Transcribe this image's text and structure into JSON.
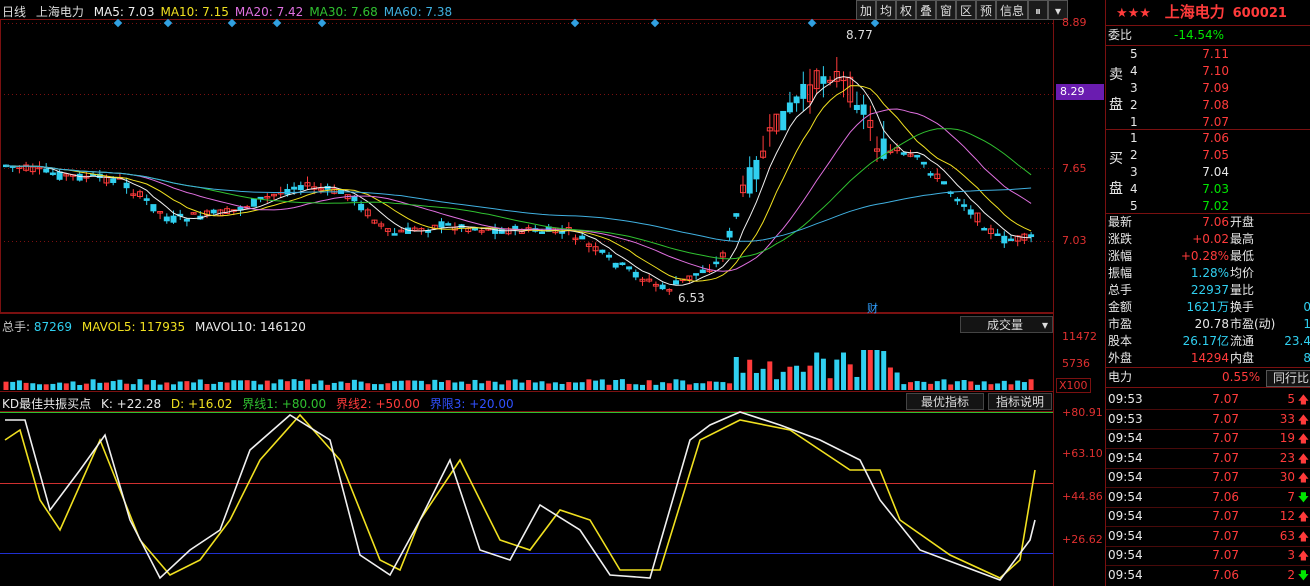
{
  "header": {
    "period": "日线",
    "stock_name": "上海电力",
    "ma": [
      {
        "label": "MA5: 7.03",
        "color": "#f0f0f0"
      },
      {
        "label": "MA10: 7.15",
        "color": "#f0e020"
      },
      {
        "label": "MA20: 7.42",
        "color": "#e070e0"
      },
      {
        "label": "MA30: 7.68",
        "color": "#30c030"
      },
      {
        "label": "MA60: 7.38",
        "color": "#40b0e0"
      }
    ]
  },
  "toolbar": [
    "加",
    "均",
    "权",
    "叠",
    "窗",
    "区",
    "预",
    "信息"
  ],
  "price_axis": [
    "8.89",
    "8.29",
    "7.65",
    "7.03"
  ],
  "price_highlight": "8.29",
  "annotations": {
    "high": "8.77",
    "low": "6.53",
    "finance_marker": "财"
  },
  "volume": {
    "label": "总手:",
    "total": "87269",
    "mavol5_label": "MAVOL5:",
    "mavol5": "117935",
    "mavol10_label": "MAVOL10:",
    "mavol10": "146120",
    "selector": "成交量",
    "axis": [
      "11472",
      "5736",
      "X100"
    ]
  },
  "indicator": {
    "name": "KD最佳共振买点",
    "k": "K: +22.28",
    "d": "D: +16.02",
    "line1": "界线1: +80.00",
    "line2": "界线2: +50.00",
    "line3": "界限3: +20.00",
    "buttons": [
      "最优指标",
      "指标说明"
    ],
    "axis": [
      "+80.91",
      "+63.10",
      "+44.86",
      "+26.62"
    ]
  },
  "panel": {
    "stars": "★★★",
    "name": "上海电力",
    "code": "600021",
    "weibi_label": "委比",
    "weibi": "-14.54%",
    "sell_label": [
      "卖",
      "盘"
    ],
    "buy_label": [
      "买",
      "盘"
    ],
    "sell": [
      {
        "n": "5",
        "price": "7.11"
      },
      {
        "n": "4",
        "price": "7.10"
      },
      {
        "n": "3",
        "price": "7.09"
      },
      {
        "n": "2",
        "price": "7.08"
      },
      {
        "n": "1",
        "price": "7.07"
      }
    ],
    "buy": [
      {
        "n": "1",
        "price": "7.06"
      },
      {
        "n": "2",
        "price": "7.05"
      },
      {
        "n": "3",
        "price": "7.04"
      },
      {
        "n": "4",
        "price": "7.03"
      },
      {
        "n": "5",
        "price": "7.02"
      }
    ],
    "stats": [
      {
        "l": "最新",
        "v": "7.06",
        "l2": "开盘",
        "v2": ""
      },
      {
        "l": "涨跌",
        "v": "+0.02",
        "l2": "最高",
        "v2": ""
      },
      {
        "l": "涨幅",
        "v": "+0.28%",
        "l2": "最低",
        "v2": ""
      },
      {
        "l": "振幅",
        "v": "1.28%",
        "l2": "均价",
        "v2": ""
      },
      {
        "l": "总手",
        "v": "22937",
        "l2": "量比",
        "v2": ""
      },
      {
        "l": "金额",
        "v": "1621万",
        "l2": "换手",
        "v2": "0"
      },
      {
        "l": "市盈",
        "v": "20.78",
        "l2": "市盈(动)",
        "v2": "1"
      },
      {
        "l": "股本",
        "v": "26.17亿",
        "l2": "流通",
        "v2": "23.4"
      },
      {
        "l": "外盘",
        "v": "14294",
        "l2": "内盘",
        "v2": "8"
      }
    ],
    "industry": {
      "name": "电力",
      "pct": "0.55%",
      "button": "同行比"
    },
    "trades": [
      {
        "t": "09:53",
        "p": "7.07",
        "v": "5",
        "dir": "up"
      },
      {
        "t": "09:53",
        "p": "7.07",
        "v": "33",
        "dir": "up"
      },
      {
        "t": "09:54",
        "p": "7.07",
        "v": "19",
        "dir": "up"
      },
      {
        "t": "09:54",
        "p": "7.07",
        "v": "23",
        "dir": "up"
      },
      {
        "t": "09:54",
        "p": "7.07",
        "v": "30",
        "dir": "up"
      },
      {
        "t": "09:54",
        "p": "7.06",
        "v": "7",
        "dir": "down"
      },
      {
        "t": "09:54",
        "p": "7.07",
        "v": "12",
        "dir": "up"
      },
      {
        "t": "09:54",
        "p": "7.07",
        "v": "63",
        "dir": "up"
      },
      {
        "t": "09:54",
        "p": "7.07",
        "v": "3",
        "dir": "up"
      },
      {
        "t": "09:54",
        "p": "7.06",
        "v": "2",
        "dir": "down"
      }
    ]
  },
  "colors": {
    "up": "#ff3b3b",
    "down": "#30d0f0",
    "grid": "#7a1010"
  }
}
